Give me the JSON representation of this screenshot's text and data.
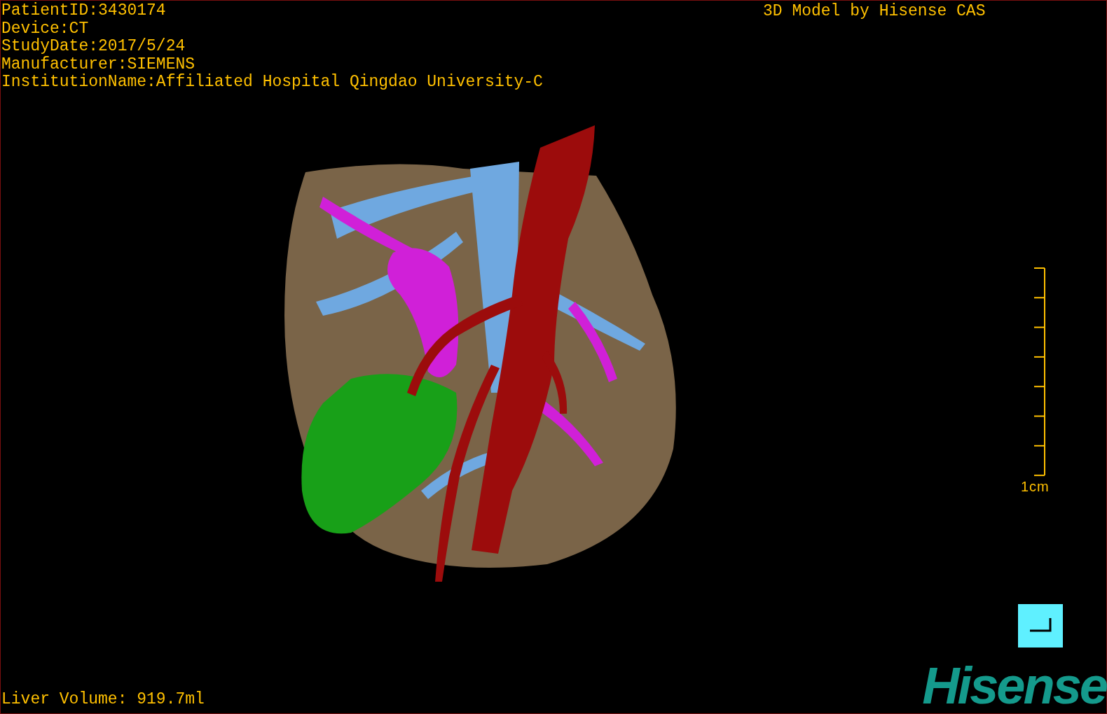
{
  "study_info": [
    "PatientID:3430174",
    "Device:CT",
    "StudyDate:2017/5/24",
    "Manufacturer:SIEMENS",
    "InstitutionName:Affiliated Hospital Qingdao University-C"
  ],
  "title": "3D Model by Hisense CAS",
  "scale_bar": {
    "label": "1cm"
  },
  "liver_volume": "Liver Volume: 919.7ml",
  "logo": "Hisense"
}
